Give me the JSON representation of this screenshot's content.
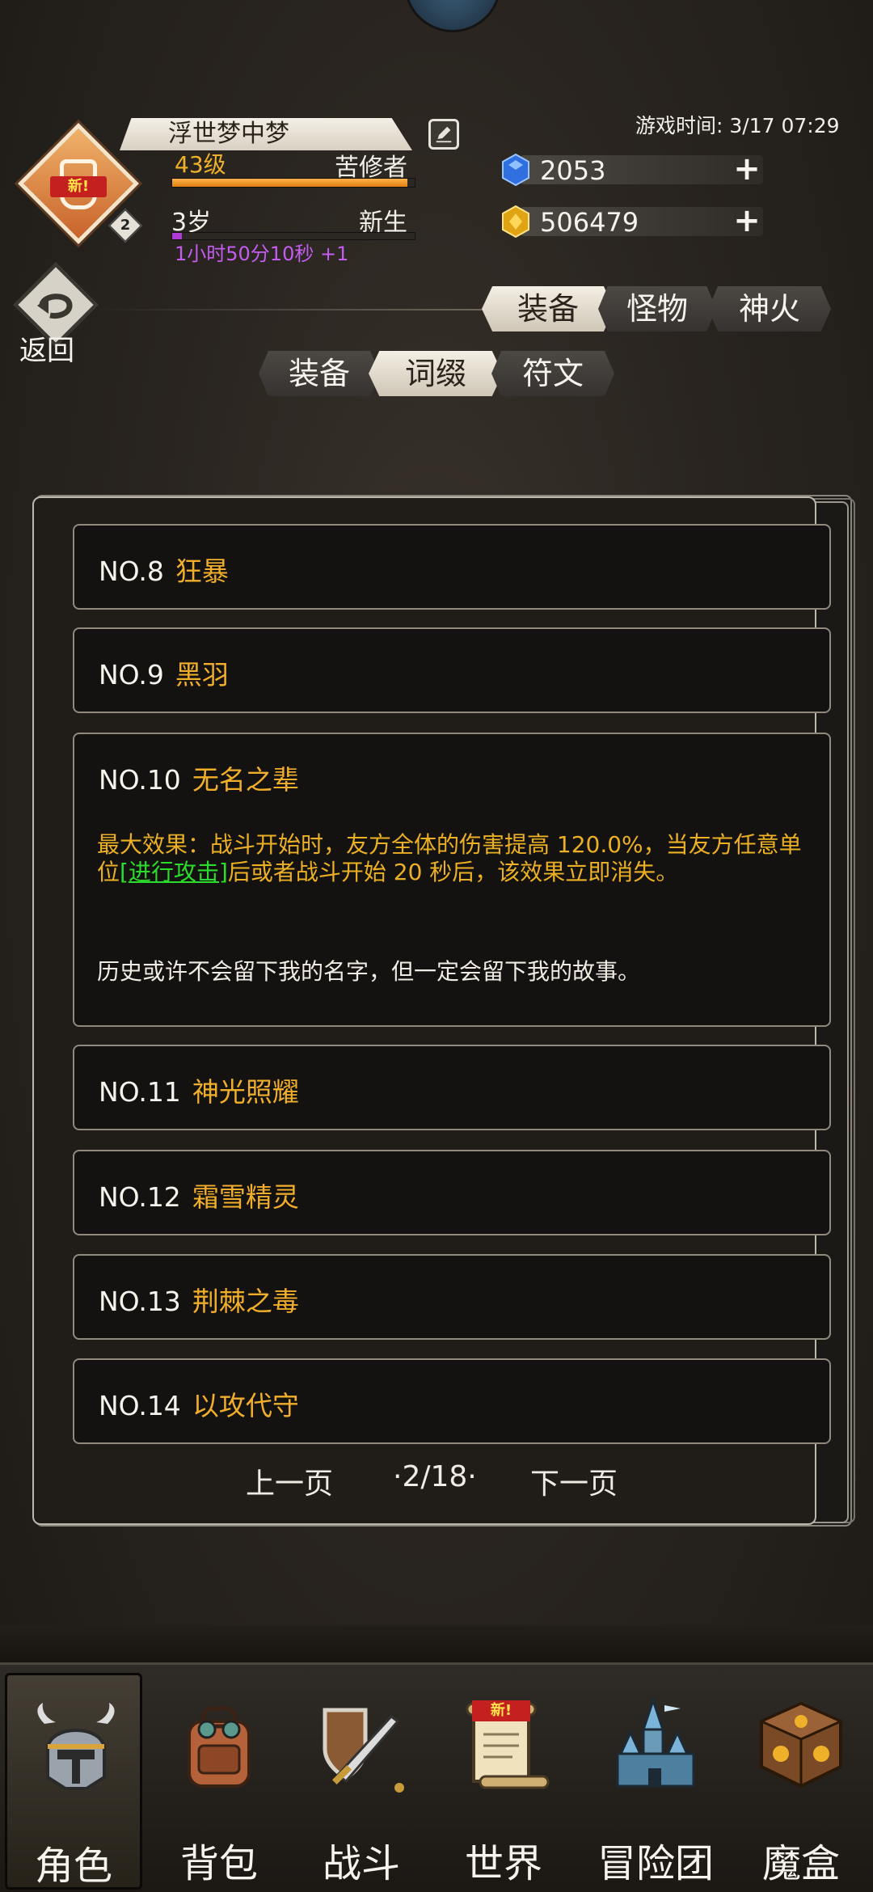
{
  "player": {
    "name": "浮世梦中梦",
    "level": "43级",
    "title": "苦修者",
    "level_progress": 0.97,
    "age": "3岁",
    "rebirth": "新生",
    "age_progress": 0.04,
    "timer": "1小时50分10秒 +1",
    "avatar_new_badge": "新!",
    "avatar_count": "2"
  },
  "game_time": "游戏时间: 3/17 07:29",
  "resources": {
    "gems": "2053",
    "gold": "506479"
  },
  "back_label": "返回",
  "top_tabs": [
    {
      "label": "装备",
      "active": true
    },
    {
      "label": "怪物",
      "active": false
    },
    {
      "label": "神火",
      "active": false
    }
  ],
  "sub_tabs": [
    {
      "label": "装备",
      "active": false
    },
    {
      "label": "词缀",
      "active": true
    },
    {
      "label": "符文",
      "active": false
    }
  ],
  "entries": [
    {
      "no": "NO.8",
      "name": "狂暴"
    },
    {
      "no": "NO.9",
      "name": "黑羽"
    },
    {
      "no": "NO.10",
      "name": "无名之辈",
      "effect_pre": "最大效果：战斗开始时，友方全体的伤害提高 120.0%，当友方任意单位",
      "effect_hl": "[进行攻击]",
      "effect_post": "后或者战斗开始 20 秒后，该效果立即消失。",
      "lore": "历史或许不会留下我的名字，但一定会留下我的故事。"
    },
    {
      "no": "NO.11",
      "name": "神光照耀"
    },
    {
      "no": "NO.12",
      "name": "霜雪精灵"
    },
    {
      "no": "NO.13",
      "name": "荆棘之毒"
    },
    {
      "no": "NO.14",
      "name": "以攻代守"
    }
  ],
  "pager": {
    "prev": "上一页",
    "current": "·2/18·",
    "next": "下一页"
  },
  "bottom_nav": [
    {
      "label": "角色",
      "icon": "helmet-icon",
      "active": true
    },
    {
      "label": "背包",
      "icon": "backpack-icon",
      "active": false
    },
    {
      "label": "战斗",
      "icon": "sword-shield-icon",
      "active": false
    },
    {
      "label": "世界",
      "icon": "scroll-icon",
      "active": false,
      "badge": "新!"
    },
    {
      "label": "冒险团",
      "icon": "castle-icon",
      "active": false
    },
    {
      "label": "魔盒",
      "icon": "magic-box-icon",
      "active": false
    }
  ],
  "colors": {
    "accent_gold": "#f0ae2a",
    "highlight_green": "#2cdc2c",
    "timer_purple": "#c45cf0"
  }
}
